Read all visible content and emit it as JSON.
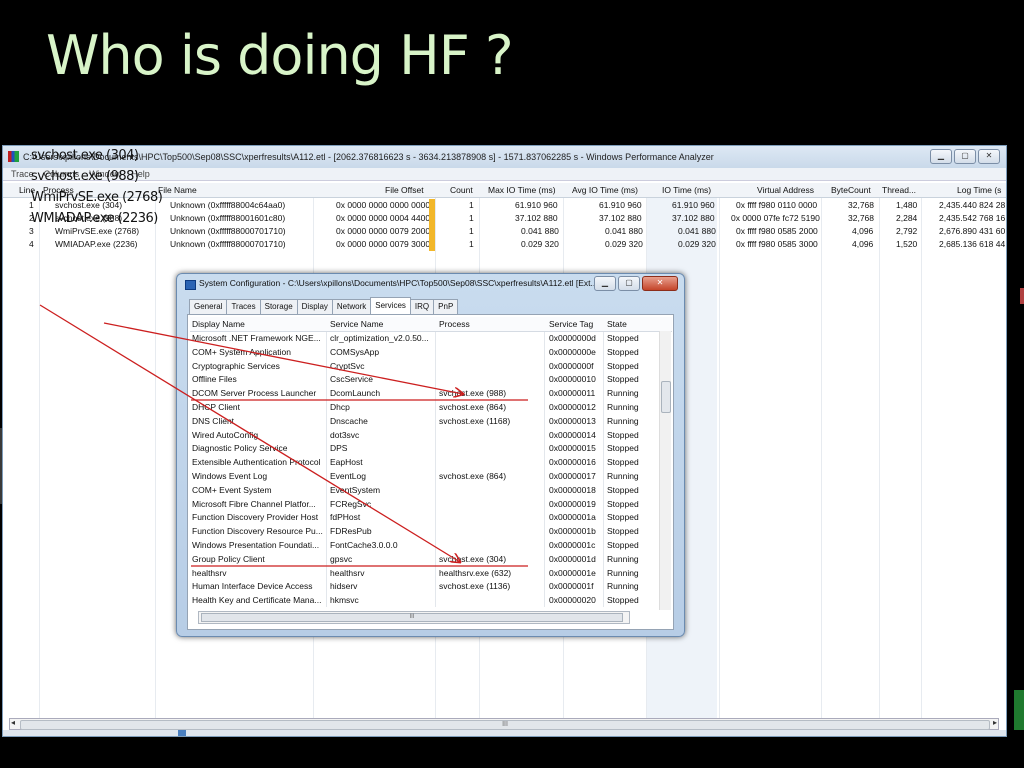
{
  "slide": {
    "title": "Who is doing HF ?"
  },
  "wpa": {
    "title": "C:\\Users\\xpillons\\Documents\\HPC\\Top500\\Sep08\\SSC\\xperfresults\\A112.etl - [2062.376816623 s - 3634.213878908 s] - 1571.837062285 s - Windows Performance Analyzer",
    "menu": [
      "Trace",
      "Columns",
      "Window",
      "Help"
    ],
    "columns": [
      "Line",
      "Process",
      "File Name",
      "File Offset",
      "Count",
      "Max IO Time (ms)",
      "Avg IO Time (ms)",
      "IO Time (ms)",
      "Virtual Address",
      "ByteCount",
      "Thread...",
      "Log Time (s"
    ],
    "rows": [
      [
        "1",
        "svchost.exe (304)",
        "Unknown (0xfffff88004c64aa0)",
        "0x 0000 0000 0000 0000",
        "1",
        "61.910 960",
        "61.910 960",
        "61.910 960",
        "0x ffff f980 0110 0000",
        "32,768",
        "1,480",
        "2,435.440 824 28"
      ],
      [
        "2",
        "svchost.exe (988)",
        "Unknown (0xfffff88001601c80)",
        "0x 0000 0000 0004 4400",
        "1",
        "37.102 880",
        "37.102 880",
        "37.102 880",
        "0x 0000 07fe fc72 5190",
        "32,768",
        "2,284",
        "2,435.542 768 16"
      ],
      [
        "3",
        "WmiPrvSE.exe (2768)",
        "Unknown (0xfffff88000701710)",
        "0x 0000 0000 0079 2000",
        "1",
        "0.041 880",
        "0.041 880",
        "0.041 880",
        "0x ffff f980 0585 2000",
        "4,096",
        "2,792",
        "2,676.890 431 60"
      ],
      [
        "4",
        "WMIADAP.exe (2236)",
        "Unknown (0xfffff88000701710)",
        "0x 0000 0000 0079 3000",
        "1",
        "0.029 320",
        "0.029 320",
        "0.029 320",
        "0x ffff f980 0585 3000",
        "4,096",
        "1,520",
        "2,685.136 618 44"
      ]
    ],
    "scroll_grip": "III"
  },
  "process_list": [
    "svchost.exe (304)",
    "svchost.exe (988)",
    "WmiPrvSE.exe (2768)",
    "WMIADAP.exe (2236)"
  ],
  "dialog": {
    "title": "System Configuration - C:\\Users\\xpillons\\Documents\\HPC\\Top500\\Sep08\\SSC\\xperfresults\\A112.etl [Ext...",
    "tabs": [
      "General",
      "Traces",
      "Storage",
      "Display",
      "Network",
      "Services",
      "IRQ",
      "PnP"
    ],
    "active_tab": "Services",
    "columns": [
      "Display Name",
      "Service Name",
      "Process",
      "Service Tag",
      "State"
    ],
    "rows": [
      [
        "Microsoft .NET Framework NGE...",
        "clr_optimization_v2.0.50...",
        "",
        "0x0000000d",
        "Stopped"
      ],
      [
        "COM+ System Application",
        "COMSysApp",
        "",
        "0x0000000e",
        "Stopped"
      ],
      [
        "Cryptographic Services",
        "CryptSvc",
        "",
        "0x0000000f",
        "Stopped"
      ],
      [
        "Offline Files",
        "CscService",
        "",
        "0x00000010",
        "Stopped"
      ],
      [
        "DCOM Server Process Launcher",
        "DcomLaunch",
        "svchost.exe (988)",
        "0x00000011",
        "Running"
      ],
      [
        "DHCP Client",
        "Dhcp",
        "svchost.exe (864)",
        "0x00000012",
        "Running"
      ],
      [
        "DNS Client",
        "Dnscache",
        "svchost.exe (1168)",
        "0x00000013",
        "Running"
      ],
      [
        "Wired AutoConfig",
        "dot3svc",
        "",
        "0x00000014",
        "Stopped"
      ],
      [
        "Diagnostic Policy Service",
        "DPS",
        "",
        "0x00000015",
        "Stopped"
      ],
      [
        "Extensible Authentication Protocol",
        "EapHost",
        "",
        "0x00000016",
        "Stopped"
      ],
      [
        "Windows Event Log",
        "EventLog",
        "svchost.exe (864)",
        "0x00000017",
        "Running"
      ],
      [
        "COM+ Event System",
        "EventSystem",
        "",
        "0x00000018",
        "Stopped"
      ],
      [
        "Microsoft Fibre Channel Platfor...",
        "FCRegSvc",
        "",
        "0x00000019",
        "Stopped"
      ],
      [
        "Function Discovery Provider Host",
        "fdPHost",
        "",
        "0x0000001a",
        "Stopped"
      ],
      [
        "Function Discovery Resource Pu...",
        "FDResPub",
        "",
        "0x0000001b",
        "Stopped"
      ],
      [
        "Windows Presentation Foundati...",
        "FontCache3.0.0.0",
        "",
        "0x0000001c",
        "Stopped"
      ],
      [
        "Group Policy Client",
        "gpsvc",
        "svchost.exe (304)",
        "0x0000001d",
        "Running"
      ],
      [
        "healthsrv",
        "healthsrv",
        "healthsrv.exe (632)",
        "0x0000001e",
        "Running"
      ],
      [
        "Human Interface Device Access",
        "hidserv",
        "svchost.exe (1136)",
        "0x0000001f",
        "Running"
      ],
      [
        "Health Key and Certificate Mana...",
        "hkmsvc",
        "",
        "0x00000020",
        "Stopped"
      ]
    ],
    "scroll_grip": "III"
  },
  "colors": {
    "slide_bg": "#000000",
    "title": "#d8f4c8",
    "annotation": "#cc1f1f",
    "io_bar": "#f2b72a"
  }
}
